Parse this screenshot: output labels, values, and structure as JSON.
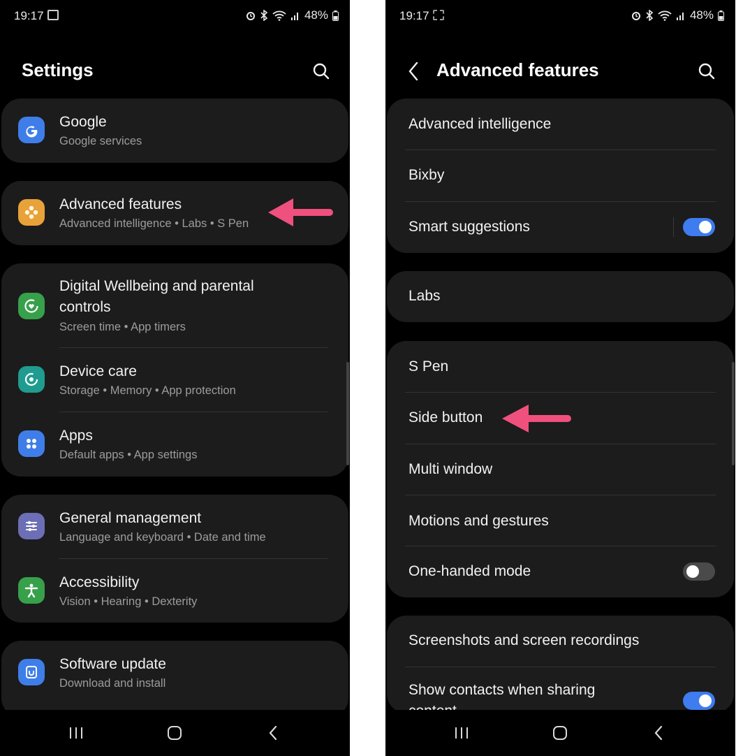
{
  "left": {
    "status": {
      "time": "19:17",
      "battery": "48%"
    },
    "title": "Settings",
    "groups": [
      {
        "items": [
          {
            "title": "Google",
            "subtitle": "Google services",
            "icon": "google-icon",
            "color": "#3f7ee8"
          }
        ]
      },
      {
        "items": [
          {
            "title": "Advanced features",
            "subtitle": "Advanced intelligence  •  Labs  •  S Pen",
            "icon": "advanced-features-icon",
            "color": "#e8a23a"
          }
        ]
      },
      {
        "items": [
          {
            "title": "Digital Wellbeing and parental",
            "title2": "controls",
            "subtitle": "Screen time  •  App timers",
            "icon": "digital-wellbeing-icon",
            "color": "#37a04a"
          },
          {
            "title": "Device care",
            "subtitle": "Storage  •  Memory  •  App protection",
            "icon": "device-care-icon",
            "color": "#1f9c8f"
          },
          {
            "title": "Apps",
            "subtitle": "Default apps  •  App settings",
            "icon": "apps-icon",
            "color": "#3f7ee8"
          }
        ]
      },
      {
        "items": [
          {
            "title": "General management",
            "subtitle": "Language and keyboard  •  Date and time",
            "icon": "general-management-icon",
            "color": "#6c6fb5"
          },
          {
            "title": "Accessibility",
            "subtitle": "Vision  •  Hearing  •  Dexterity",
            "icon": "accessibility-icon",
            "color": "#37a04a"
          }
        ]
      },
      {
        "items": [
          {
            "title": "Software update",
            "subtitle": "Download and install",
            "icon": "software-update-icon",
            "color": "#3f7ee8"
          }
        ]
      }
    ]
  },
  "right": {
    "status": {
      "time": "19:17",
      "battery": "48%"
    },
    "title": "Advanced features",
    "groups": [
      {
        "items": [
          {
            "title": "Advanced intelligence"
          },
          {
            "title": "Bixby"
          },
          {
            "title": "Smart suggestions",
            "toggle": true
          }
        ]
      },
      {
        "items": [
          {
            "title": "Labs"
          }
        ]
      },
      {
        "items": [
          {
            "title": "S Pen"
          },
          {
            "title": "Side button"
          },
          {
            "title": "Multi window"
          },
          {
            "title": "Motions and gestures"
          },
          {
            "title": "One-handed mode",
            "toggle": false
          }
        ]
      },
      {
        "items": [
          {
            "title": "Screenshots and screen recordings"
          },
          {
            "title": "Show contacts when sharing",
            "title2": "content",
            "toggle": true
          }
        ]
      }
    ]
  },
  "colors": {
    "annotation_arrow": "#f0507e",
    "toggle_on": "#3e7cf0",
    "card": "#1c1c1c",
    "background": "#000000"
  }
}
